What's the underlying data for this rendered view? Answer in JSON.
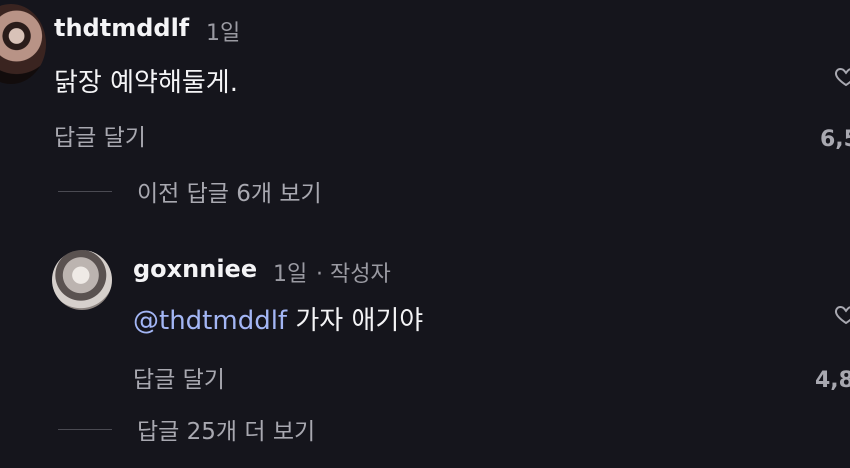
{
  "comments": [
    {
      "username": "thdtmddlf",
      "time": "1일",
      "text": "닭장 예약해둘게.",
      "reply_label": "답글 달기",
      "like_count": "6,5",
      "view_replies": "이전 답글 6개 보기"
    },
    {
      "username": "goxnniee",
      "time": "1일",
      "author_badge": "· 작성자",
      "mention": "@thdtmddlf",
      "text": "가자 애기야",
      "reply_label": "답글 달기",
      "like_count": "4,8",
      "view_replies": "답글 25개 더 보기"
    }
  ],
  "icons": {
    "like": "heart-icon"
  },
  "colors": {
    "background": "#15151c",
    "mention": "#a3b6f5",
    "secondary_text": "#a8a8b0"
  }
}
